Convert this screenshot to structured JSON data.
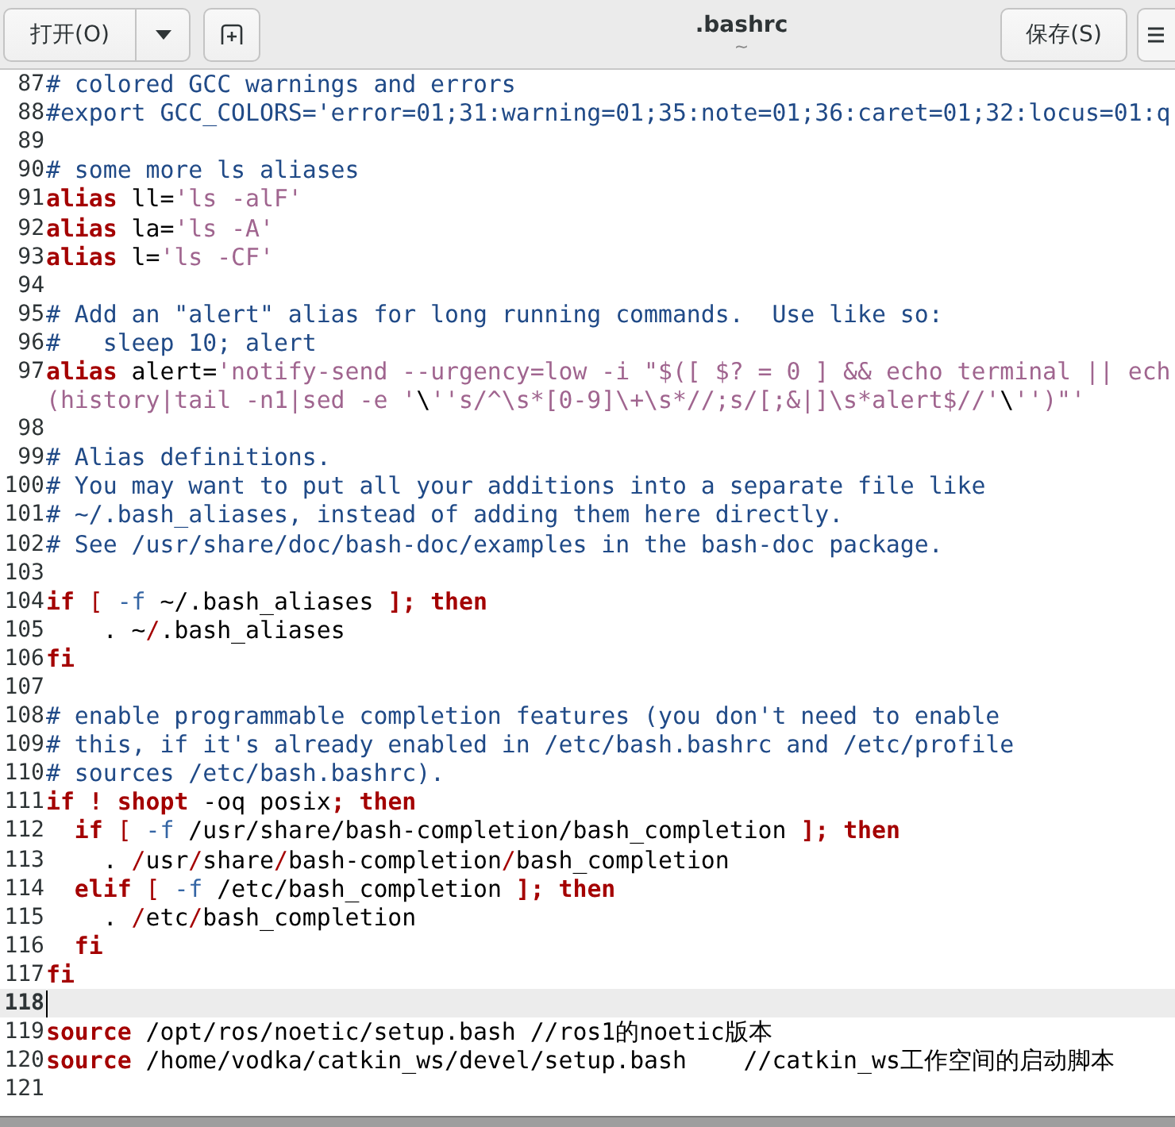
{
  "header": {
    "open_button": "打开(O)",
    "title": ".bashrc",
    "subtitle": "~",
    "save_button": "保存(S)"
  },
  "lines": [
    {
      "number": "87",
      "current": false,
      "segments": [
        {
          "kind": "comment",
          "text": "# colored GCC warnings and errors"
        }
      ]
    },
    {
      "number": "88",
      "current": false,
      "segments": [
        {
          "kind": "comment",
          "text": "#export GCC_COLORS='error=01;31:warning=01;35:note=01;36:caret=01;32:locus=01:q"
        }
      ]
    },
    {
      "number": "89",
      "current": false
    },
    {
      "number": "90",
      "current": false,
      "segments": [
        {
          "kind": "comment",
          "text": "# some more ls aliases"
        }
      ]
    },
    {
      "number": "91",
      "current": false,
      "segments": [
        {
          "kind": "keyword",
          "text": "alias"
        },
        {
          "kind": "plain",
          "text": " ll="
        },
        {
          "kind": "string",
          "text": "'ls -alF'"
        }
      ]
    },
    {
      "number": "92",
      "current": false,
      "segments": [
        {
          "kind": "keyword",
          "text": "alias"
        },
        {
          "kind": "plain",
          "text": " la="
        },
        {
          "kind": "string",
          "text": "'ls -A'"
        }
      ]
    },
    {
      "number": "93",
      "current": false,
      "segments": [
        {
          "kind": "keyword",
          "text": "alias"
        },
        {
          "kind": "plain",
          "text": " l="
        },
        {
          "kind": "string",
          "text": "'ls -CF'"
        }
      ]
    },
    {
      "number": "94",
      "current": false
    },
    {
      "number": "95",
      "current": false,
      "segments": [
        {
          "kind": "comment",
          "text": "# Add an \"alert\" alias for long running commands.  Use like so:"
        }
      ]
    },
    {
      "number": "96",
      "current": false,
      "segments": [
        {
          "kind": "comment",
          "text": "#   sleep 10; alert"
        }
      ]
    },
    {
      "number": "97",
      "current": false,
      "segments": [
        {
          "kind": "keyword",
          "text": "alias"
        },
        {
          "kind": "plain",
          "text": " alert="
        },
        {
          "kind": "string",
          "text": "'notify-send --urgency=low -i \"$([ $? = 0 ] && echo terminal || ech"
        }
      ]
    },
    {
      "current": false,
      "segments": [
        {
          "kind": "string",
          "text": "(history|tail -n1|sed -e '"
        },
        {
          "kind": "plain",
          "text": "\\"
        },
        {
          "kind": "string",
          "text": "''s/^\\s*[0-9]\\+\\s*//;s/[;&|]\\s*alert$//'"
        },
        {
          "kind": "plain",
          "text": "\\"
        },
        {
          "kind": "string",
          "text": "'')\"'"
        }
      ]
    },
    {
      "number": "98",
      "current": false
    },
    {
      "number": "99",
      "current": false,
      "segments": [
        {
          "kind": "comment",
          "text": "# Alias definitions."
        }
      ]
    },
    {
      "number": "100",
      "current": false,
      "segments": [
        {
          "kind": "comment",
          "text": "# You may want to put all your additions into a separate file like"
        }
      ]
    },
    {
      "number": "101",
      "current": false,
      "segments": [
        {
          "kind": "comment",
          "text": "# ~/.bash_aliases, instead of adding them here directly."
        }
      ]
    },
    {
      "number": "102",
      "current": false,
      "segments": [
        {
          "kind": "comment",
          "text": "# See /usr/share/doc/bash-doc/examples in the bash-doc package."
        }
      ]
    },
    {
      "number": "103",
      "current": false
    },
    {
      "number": "104",
      "current": false,
      "segments": [
        {
          "kind": "keyword",
          "text": "if"
        },
        {
          "kind": "operator",
          "text": " ["
        },
        {
          "kind": "option",
          "text": " -f"
        },
        {
          "kind": "plain",
          "text": " ~/.bash_aliases "
        },
        {
          "kind": "punct",
          "text": "];"
        },
        {
          "kind": "keyword",
          "text": " then"
        }
      ]
    },
    {
      "number": "105",
      "current": false,
      "segments": [
        {
          "kind": "plain",
          "text": "    . ~"
        },
        {
          "kind": "operator",
          "text": "/"
        },
        {
          "kind": "plain",
          "text": ".bash_aliases"
        }
      ]
    },
    {
      "number": "106",
      "current": false,
      "segments": [
        {
          "kind": "keyword",
          "text": "fi"
        }
      ]
    },
    {
      "number": "107",
      "current": false
    },
    {
      "number": "108",
      "current": false,
      "segments": [
        {
          "kind": "comment",
          "text": "# enable programmable completion features (you don't need to enable"
        }
      ]
    },
    {
      "number": "109",
      "current": false,
      "segments": [
        {
          "kind": "comment",
          "text": "# this, if it's already enabled in /etc/bash.bashrc and /etc/profile"
        }
      ]
    },
    {
      "number": "110",
      "current": false,
      "segments": [
        {
          "kind": "comment",
          "text": "# sources /etc/bash.bashrc)."
        }
      ]
    },
    {
      "number": "111",
      "current": false,
      "segments": [
        {
          "kind": "keyword",
          "text": "if"
        },
        {
          "kind": "keyword",
          "text": " !"
        },
        {
          "kind": "keyword",
          "text": " shopt"
        },
        {
          "kind": "plain",
          "text": " -oq posix"
        },
        {
          "kind": "punct",
          "text": ";"
        },
        {
          "kind": "keyword",
          "text": " then"
        }
      ]
    },
    {
      "number": "112",
      "current": false,
      "segments": [
        {
          "kind": "keyword",
          "text": "  if"
        },
        {
          "kind": "operator",
          "text": " ["
        },
        {
          "kind": "option",
          "text": " -f"
        },
        {
          "kind": "plain",
          "text": " /usr/share/bash-completion/bash_completion "
        },
        {
          "kind": "punct",
          "text": "];"
        },
        {
          "kind": "keyword",
          "text": " then"
        }
      ]
    },
    {
      "number": "113",
      "current": false,
      "segments": [
        {
          "kind": "plain",
          "text": "    . "
        },
        {
          "kind": "operator",
          "text": "/"
        },
        {
          "kind": "plain",
          "text": "usr"
        },
        {
          "kind": "operator",
          "text": "/"
        },
        {
          "kind": "plain",
          "text": "share"
        },
        {
          "kind": "operator",
          "text": "/"
        },
        {
          "kind": "plain",
          "text": "bash-completion"
        },
        {
          "kind": "operator",
          "text": "/"
        },
        {
          "kind": "plain",
          "text": "bash_completion"
        }
      ]
    },
    {
      "number": "114",
      "current": false,
      "segments": [
        {
          "kind": "keyword",
          "text": "  elif"
        },
        {
          "kind": "operator",
          "text": " ["
        },
        {
          "kind": "option",
          "text": " -f"
        },
        {
          "kind": "plain",
          "text": " /etc/bash_completion "
        },
        {
          "kind": "punct",
          "text": "];"
        },
        {
          "kind": "keyword",
          "text": " then"
        }
      ]
    },
    {
      "number": "115",
      "current": false,
      "segments": [
        {
          "kind": "plain",
          "text": "    . "
        },
        {
          "kind": "operator",
          "text": "/"
        },
        {
          "kind": "plain",
          "text": "etc"
        },
        {
          "kind": "operator",
          "text": "/"
        },
        {
          "kind": "plain",
          "text": "bash_completion"
        }
      ]
    },
    {
      "number": "116",
      "current": false,
      "segments": [
        {
          "kind": "keyword",
          "text": "  fi"
        }
      ]
    },
    {
      "number": "117",
      "current": false,
      "segments": [
        {
          "kind": "keyword",
          "text": "fi"
        }
      ]
    },
    {
      "number": "118",
      "current": true
    },
    {
      "number": "119",
      "current": false,
      "segments": [
        {
          "kind": "keyword",
          "text": "source"
        },
        {
          "kind": "plain",
          "text": " /opt/ros/noetic/setup.bash //ros1的noetic版本"
        }
      ]
    },
    {
      "number": "120",
      "current": false,
      "segments": [
        {
          "kind": "keyword",
          "text": "source"
        },
        {
          "kind": "plain",
          "text": " /home/vodka/catkin_ws/devel/setup.bash    //catkin_ws工作空间的启动脚本"
        }
      ]
    },
    {
      "number": "121",
      "current": false
    }
  ]
}
